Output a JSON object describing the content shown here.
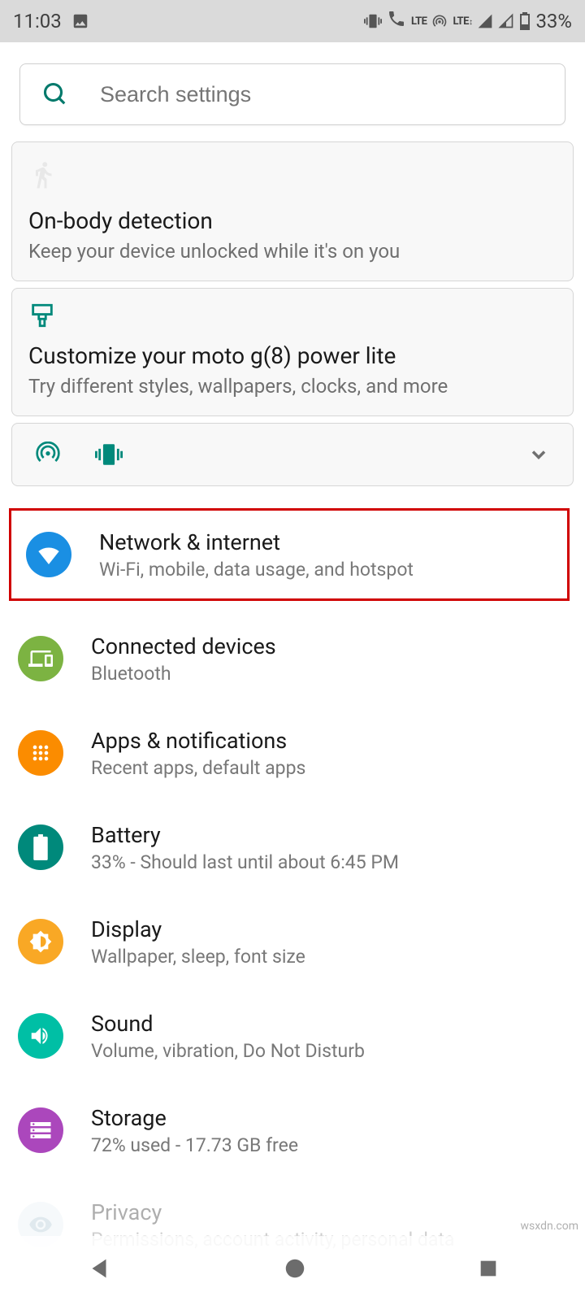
{
  "status": {
    "time": "11:03",
    "battery_pct": "33%"
  },
  "search": {
    "placeholder": "Search settings"
  },
  "cards": {
    "onbody": {
      "title": "On-body detection",
      "sub": "Keep your device unlocked while it's on you"
    },
    "customize": {
      "title": "Customize your moto g(8) power lite",
      "sub": "Try different styles, wallpapers, clocks, and more"
    }
  },
  "rows": {
    "network": {
      "title": "Network & internet",
      "sub": "Wi-Fi, mobile, data usage, and hotspot"
    },
    "connected": {
      "title": "Connected devices",
      "sub": "Bluetooth"
    },
    "apps": {
      "title": "Apps & notifications",
      "sub": "Recent apps, default apps"
    },
    "battery": {
      "title": "Battery",
      "sub": "33% - Should last until about 6:45 PM"
    },
    "display": {
      "title": "Display",
      "sub": "Wallpaper, sleep, font size"
    },
    "sound": {
      "title": "Sound",
      "sub": "Volume, vibration, Do Not Disturb"
    },
    "storage": {
      "title": "Storage",
      "sub": "72% used - 17.73 GB free"
    },
    "privacy": {
      "title": "Privacy",
      "sub": "Permissions, account activity, personal data"
    }
  },
  "watermark": "wsxdn.com"
}
